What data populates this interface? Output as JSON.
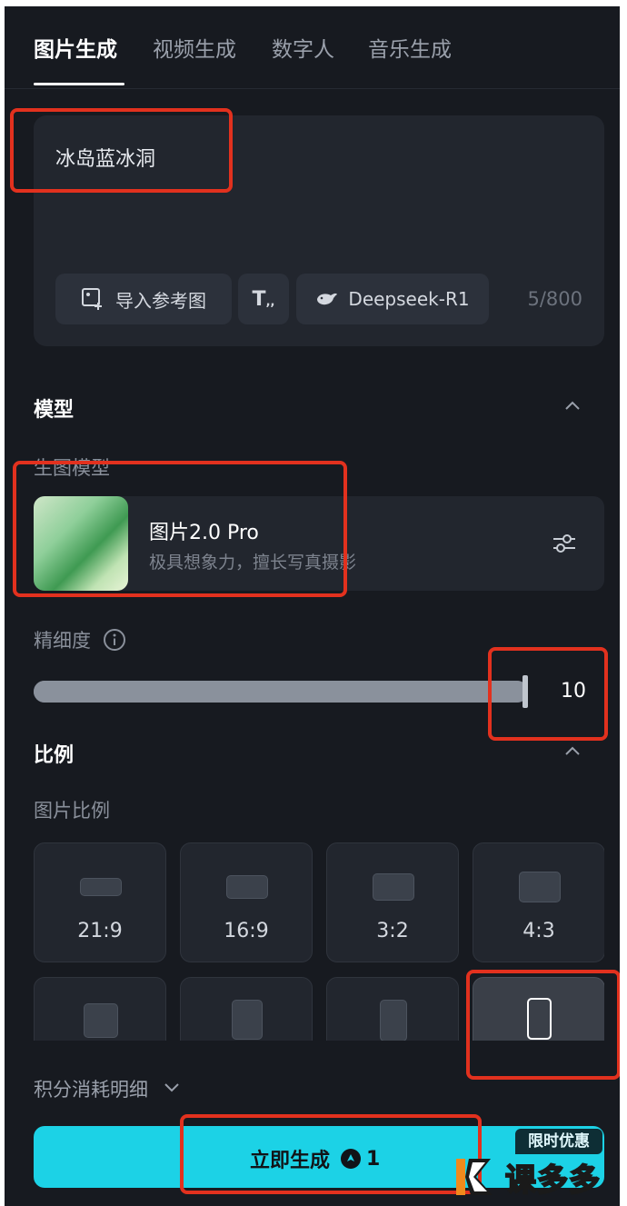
{
  "tabs": [
    {
      "label": "图片生成",
      "active": true
    },
    {
      "label": "视频生成",
      "active": false
    },
    {
      "label": "数字人",
      "active": false
    },
    {
      "label": "音乐生成",
      "active": false
    }
  ],
  "prompt": {
    "text": "冰岛蓝冰洞",
    "import_ref_label": "导入参考图",
    "text_tool_icon": "text-format-icon",
    "model_chip_label": "Deepseek-R1",
    "counter": "5/800"
  },
  "model_section": {
    "title": "模型",
    "sub_label": "生图模型",
    "model_name": "图片2.0 Pro",
    "model_desc": "极具想象力，擅长写真摄影"
  },
  "detail": {
    "label": "精细度",
    "value": "10",
    "fraction": 1.0
  },
  "ratio_section": {
    "title": "比例",
    "sub_label": "图片比例",
    "options": [
      {
        "label": "21:9"
      },
      {
        "label": "16:9"
      },
      {
        "label": "3:2"
      },
      {
        "label": "4:3"
      },
      {
        "label": "1:1"
      },
      {
        "label": "3:4"
      },
      {
        "label": "2:3"
      },
      {
        "label": "9:16",
        "selected": true
      }
    ]
  },
  "footer": {
    "credits_label": "积分消耗明细",
    "generate_label": "立即生成",
    "cost": "1",
    "promo_badge": "限时优惠"
  },
  "watermark": {
    "text": "课多多"
  },
  "colors": {
    "panel_bg": "#171a20",
    "accent": "#1cd2e6",
    "annotation": "#e2311e"
  }
}
